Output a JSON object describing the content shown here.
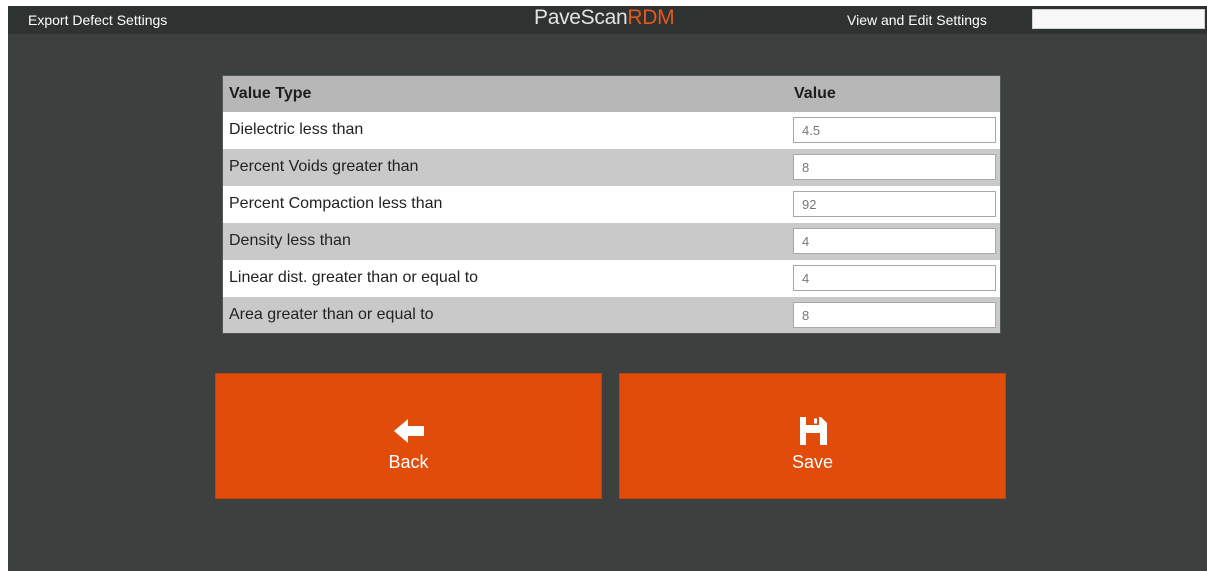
{
  "topbar": {
    "left_title": "Export Defect Settings",
    "brand_main": "PaveScan",
    "brand_accent": "RDM",
    "right_title": "View and Edit Settings",
    "search_value": ""
  },
  "table": {
    "headers": [
      "Value Type",
      "Value"
    ],
    "rows": [
      {
        "label": "Dielectric less than",
        "value": "4.5"
      },
      {
        "label": "Percent Voids greater than",
        "value": "8"
      },
      {
        "label": "Percent Compaction less than",
        "value": "92"
      },
      {
        "label": "Density less than",
        "value": "4"
      },
      {
        "label": "Linear dist. greater than or equal to",
        "value": "4"
      },
      {
        "label": "Area greater than or equal to",
        "value": "8"
      }
    ]
  },
  "buttons": {
    "back": {
      "label": "Back",
      "icon": "arrow-left-icon"
    },
    "save": {
      "label": "Save",
      "icon": "floppy-disk-icon"
    }
  },
  "colors": {
    "accent": "#e24c0b",
    "background": "#3c403f",
    "topbar": "#2e3231"
  }
}
